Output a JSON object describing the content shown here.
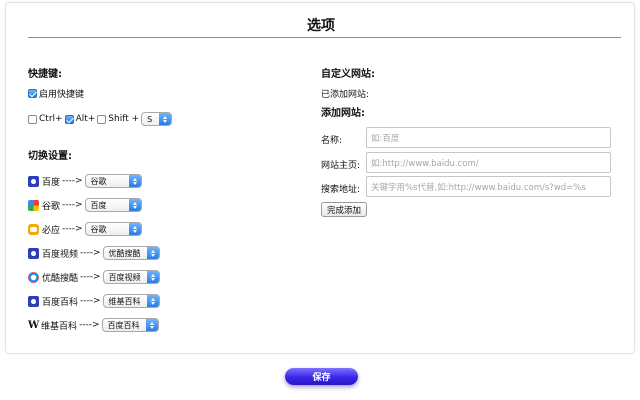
{
  "title": "选项",
  "shortcut": {
    "heading": "快捷键:",
    "enable_label": "启用快捷键",
    "enable_checked": true,
    "ctrl_label": "Ctrl+",
    "ctrl_checked": false,
    "alt_label": "Alt+",
    "alt_checked": true,
    "shift_label": "Shift +",
    "shift_checked": false,
    "key_value": "S"
  },
  "switch": {
    "heading": "切换设置:",
    "arrow": "---->",
    "items": [
      {
        "name": "百度",
        "icon": "baidu-icon",
        "target": "谷歌"
      },
      {
        "name": "谷歌",
        "icon": "google-icon",
        "target": "百度"
      },
      {
        "name": "必应",
        "icon": "bing-icon",
        "target": "谷歌"
      },
      {
        "name": "百度视频",
        "icon": "baidu-icon",
        "target": "优酷搜酷"
      },
      {
        "name": "优酷搜酷",
        "icon": "youku-icon",
        "target": "百度视频"
      },
      {
        "name": "百度百科",
        "icon": "baidu-icon",
        "target": "维基百科"
      },
      {
        "name": "维基百科",
        "icon": "wikipedia-icon",
        "target": "百度百科"
      }
    ]
  },
  "custom": {
    "heading": "自定义网站:",
    "added_label": "已添加网站:",
    "add_heading": "添加网站:",
    "name_label": "名称:",
    "name_placeholder": "如:百度",
    "home_label": "网站主页:",
    "home_placeholder": "如:http://www.baidu.com/",
    "search_label": "搜索地址:",
    "search_placeholder": "关键字用%s代替,如:http://www.baidu.com/s?wd=%s",
    "done_button": "完成添加"
  },
  "save_button": "保存",
  "colors": {
    "accent_blue": "#2a7be6",
    "save_button": "#3a25e8"
  }
}
